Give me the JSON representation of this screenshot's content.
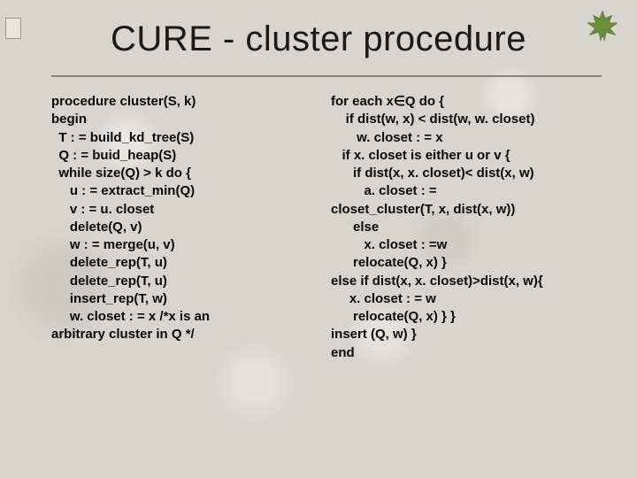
{
  "title": "CURE - cluster procedure",
  "left_column": "procedure cluster(S, k)\nbegin\n  T : = build_kd_tree(S)\n  Q : = buid_heap(S)\n  while size(Q) > k do {\n     u : = extract_min(Q)\n     v : = u. closet\n     delete(Q, v)\n     w : = merge(u, v)\n     delete_rep(T, u)\n     delete_rep(T, u)\n     insert_rep(T, w)\n     w. closet : = x /*x is an\narbitrary cluster in Q */",
  "right_column": "for each x∈Q do {\n    if dist(w, x) < dist(w, w. closet)\n       w. closet : = x\n   if x. closet is either u or v {\n      if dist(x, x. closet)< dist(x, w)\n         a. closet : =\ncloset_cluster(T, x, dist(x, w))\n      else\n         x. closet : =w\n      relocate(Q, x) }\nelse if dist(x, x. closet)>dist(x, w){\n     x. closet : = w\n      relocate(Q, x) } }\ninsert (Q, w) }\nend",
  "icons": {
    "leaf": "maple-leaf-icon",
    "marker": "page-fold-marker"
  }
}
